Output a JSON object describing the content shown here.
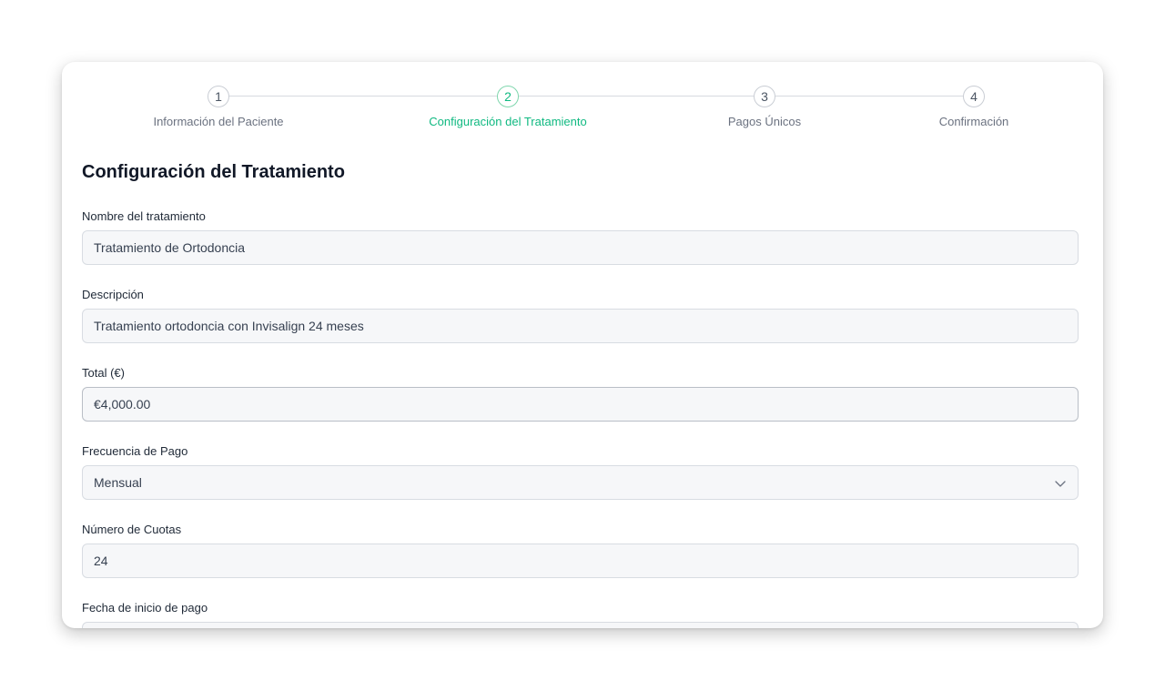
{
  "stepper": {
    "steps": [
      {
        "number": "1",
        "label": "Información del Paciente"
      },
      {
        "number": "2",
        "label": "Configuración del Tratamiento"
      },
      {
        "number": "3",
        "label": "Pagos Únicos"
      },
      {
        "number": "4",
        "label": "Confirmación"
      }
    ],
    "active_step": 2
  },
  "form": {
    "title": "Configuración del Tratamiento",
    "treatment_name": {
      "label": "Nombre del tratamiento",
      "value": "Tratamiento de Ortodoncia"
    },
    "description": {
      "label": "Descripción",
      "value": "Tratamiento ortodoncia con Invisalign 24 meses"
    },
    "total": {
      "label": "Total (€)",
      "value": "€4,000.00"
    },
    "payment_frequency": {
      "label": "Frecuencia de Pago",
      "value": "Mensual"
    },
    "installments": {
      "label": "Número de Cuotas",
      "value": "24"
    },
    "start_date": {
      "label": "Fecha de inicio de pago",
      "value": ""
    }
  },
  "colors": {
    "accent": "#10b981",
    "field_background": "#f6f7f9",
    "field_border": "#d8dce2"
  }
}
